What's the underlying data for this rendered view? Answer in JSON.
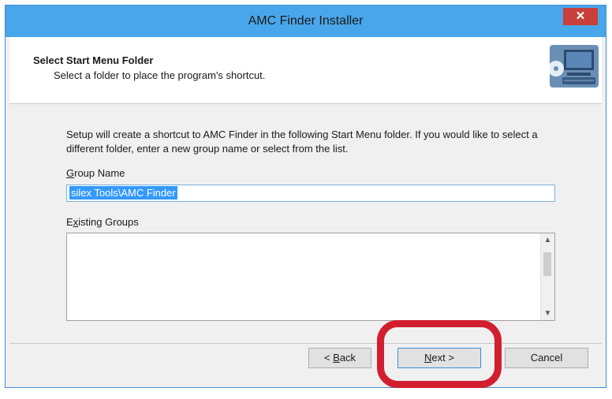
{
  "window": {
    "title": "AMC Finder Installer",
    "close_label": "✕"
  },
  "header": {
    "title": "Select Start Menu Folder",
    "subtitle": "Select a folder to place the program's shortcut.",
    "icon": "computer-icon"
  },
  "body": {
    "intro": "Setup will create a shortcut to AMC Finder in the following Start Menu folder. If you would like to select a different folder, enter a new group name or select from the list.",
    "group_name_label_accel": "G",
    "group_name_label_rest": "roup Name",
    "group_name_value": "silex Tools\\AMC Finder",
    "existing_groups_label_prefix": "E",
    "existing_groups_label_accel": "x",
    "existing_groups_label_rest": "isting Groups"
  },
  "buttons": {
    "back_prefix": "< ",
    "back_accel": "B",
    "back_rest": "ack",
    "next_accel": "N",
    "next_rest": "ext >",
    "cancel": "Cancel"
  },
  "colors": {
    "titlebar": "#4aa6ea",
    "close_button": "#c9403a",
    "selection": "#3399ff",
    "highlight_ring": "#d21f2f"
  }
}
